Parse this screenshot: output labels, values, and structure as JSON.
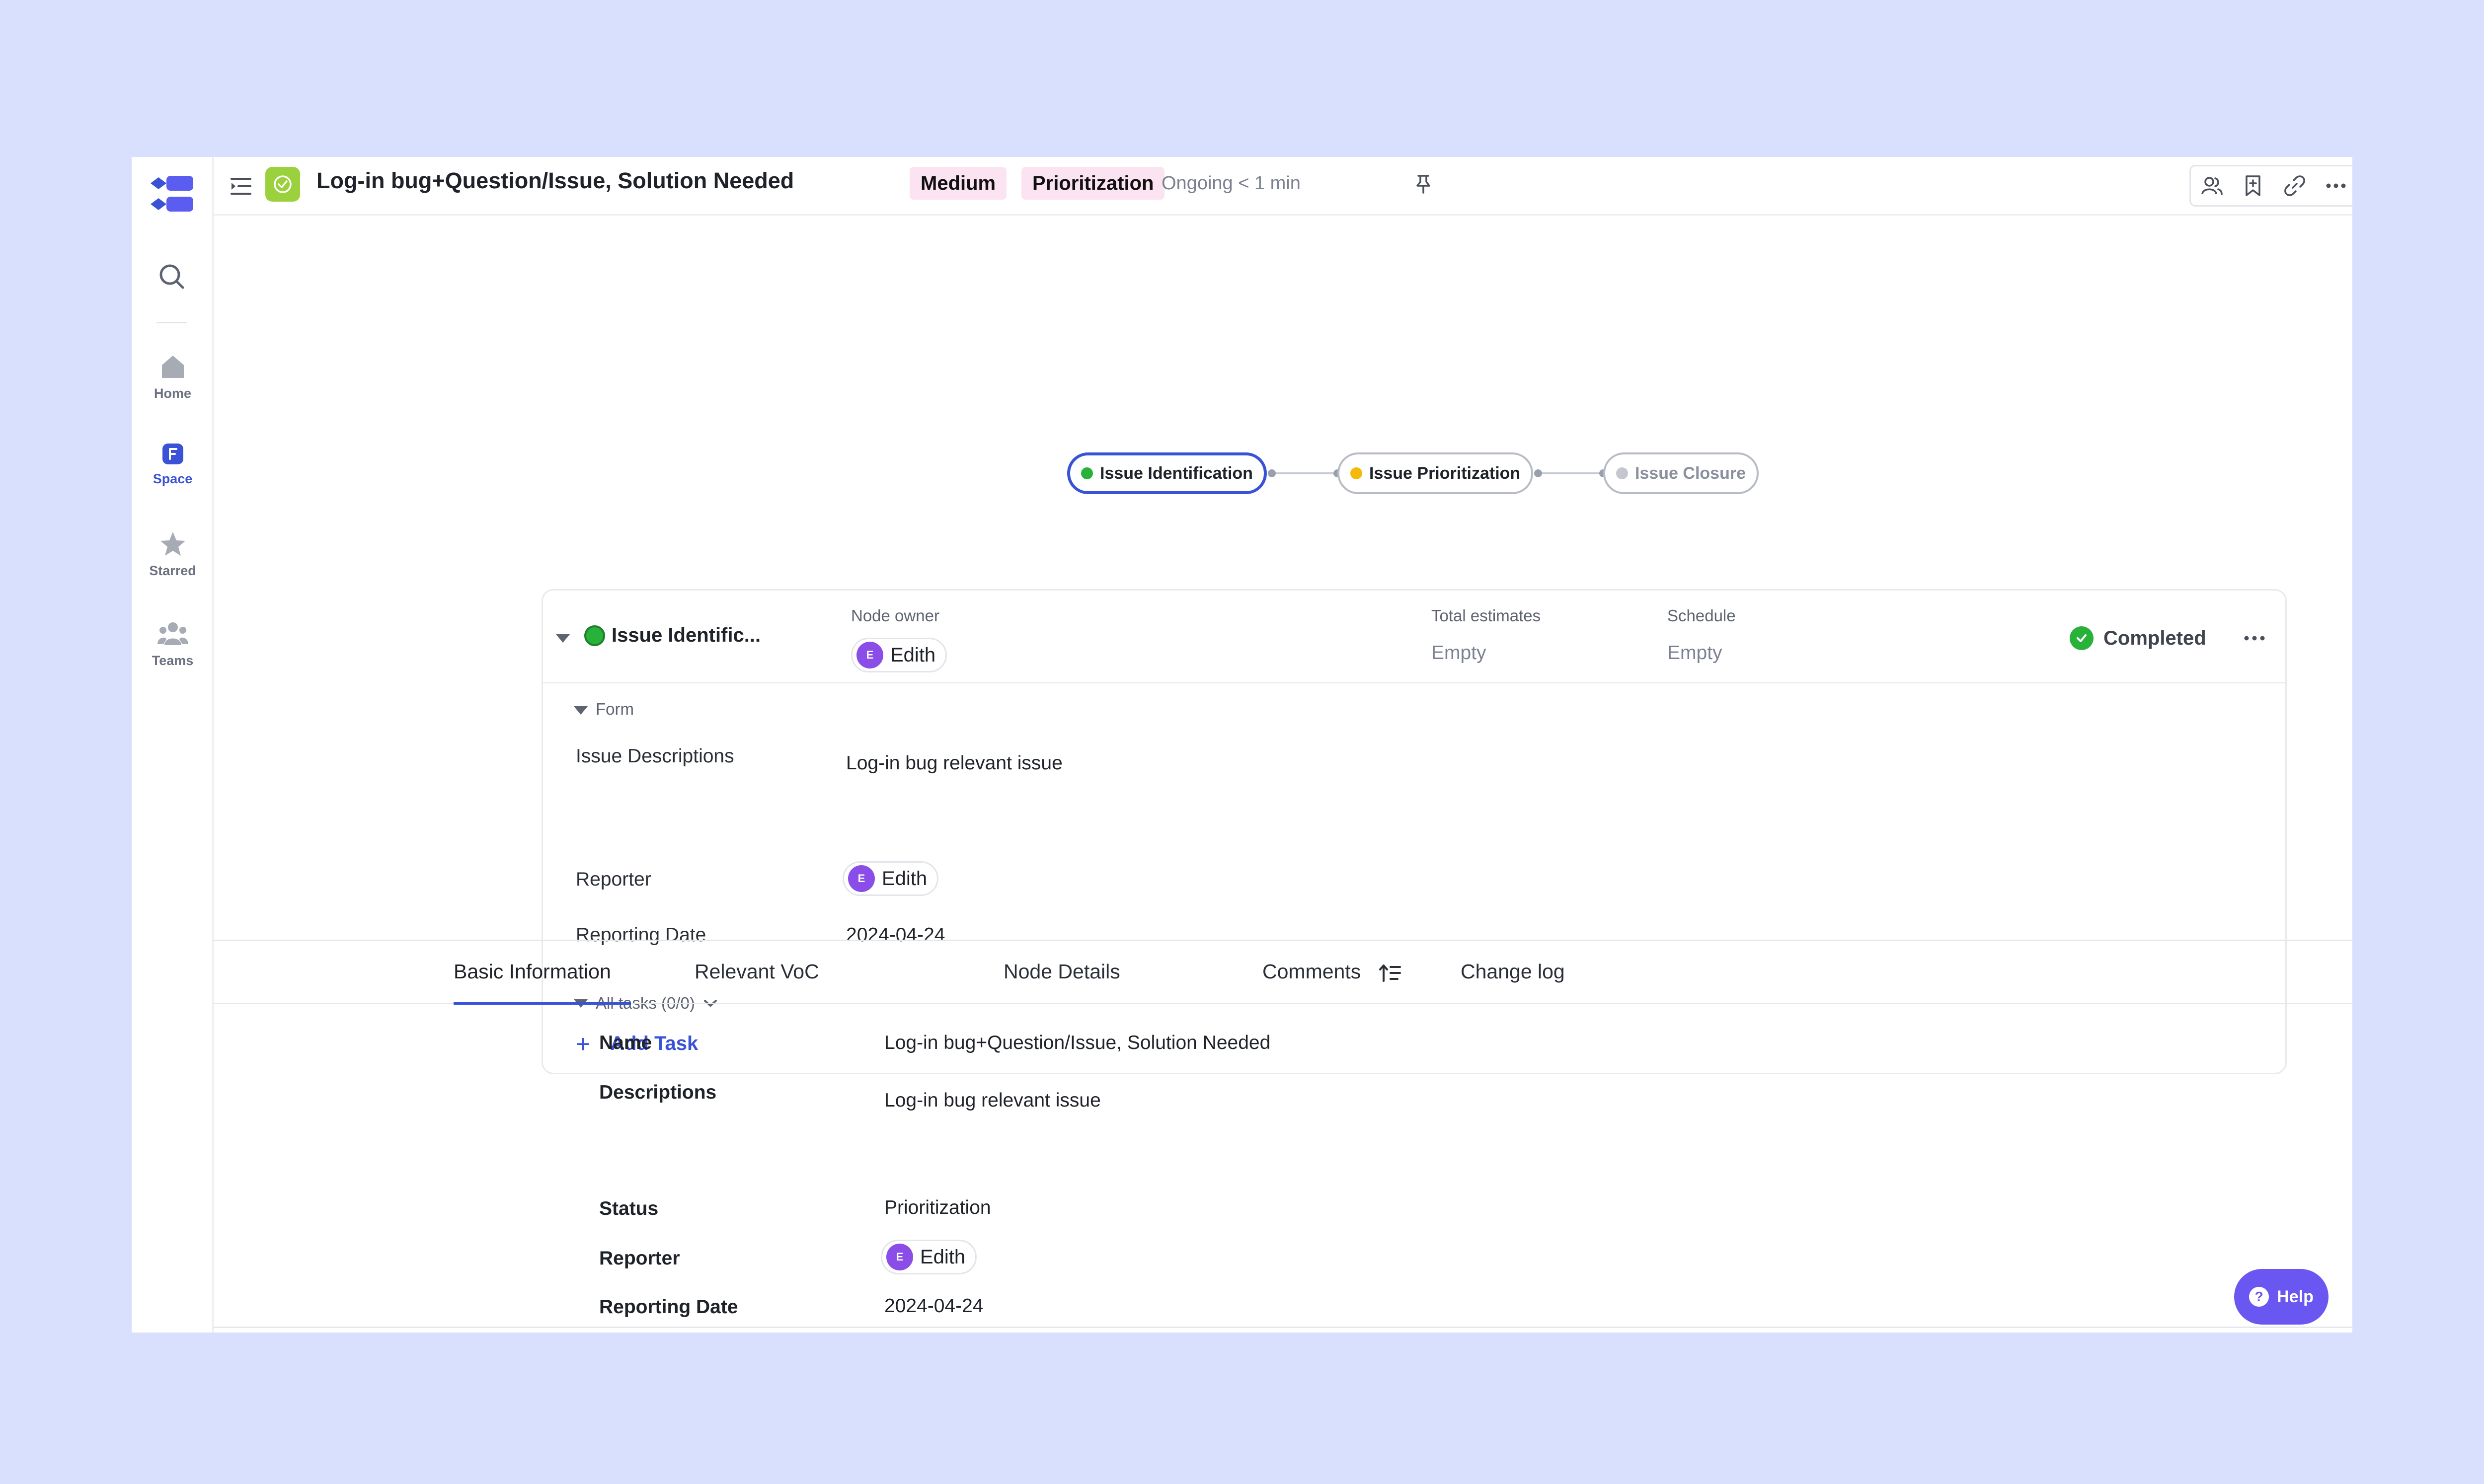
{
  "app": {
    "nav": [
      {
        "label": "Home",
        "icon": "home-icon"
      },
      {
        "label": "Space",
        "icon": "space-icon",
        "active": true
      },
      {
        "label": "Starred",
        "icon": "star-icon"
      },
      {
        "label": "Teams",
        "icon": "teams-icon"
      }
    ],
    "accent_color": "#3a53d6"
  },
  "header": {
    "title": "Log-in bug+Question/Issue, Solution Needed",
    "priority_tag": "Medium",
    "status_tag": "Prioritization",
    "ongoing": "Ongoing < 1 min",
    "actions": [
      "members-icon",
      "bookmark-icon",
      "link-icon",
      "more-icon"
    ]
  },
  "pipeline": {
    "nodes": [
      {
        "label": "Issue Identification",
        "dot_color": "#29b23a",
        "state": "current"
      },
      {
        "label": "Issue Prioritization",
        "dot_color": "#f5b90c",
        "state": "pending"
      },
      {
        "label": "Issue Closure",
        "dot_color": "#c4c7ce",
        "state": "inactive"
      }
    ]
  },
  "node_card": {
    "name": "Issue Identific...",
    "owner_label": "Node owner",
    "owner": {
      "initial": "E",
      "name": "Edith"
    },
    "estimates_label": "Total estimates",
    "estimates_value": "Empty",
    "schedule_label": "Schedule",
    "schedule_value": "Empty",
    "status": "Completed",
    "form_label": "Form",
    "form": {
      "descriptions_label": "Issue Descriptions",
      "descriptions_value": "Log-in bug relevant issue",
      "reporter_label": "Reporter",
      "reporter": {
        "initial": "E",
        "name": "Edith"
      },
      "date_label": "Reporting Date",
      "date_value": "2024-04-24"
    },
    "tasks_label": "All tasks (0/0)",
    "add_task_label": "Add Task"
  },
  "tabs": [
    {
      "label": "Basic Information",
      "active": true
    },
    {
      "label": "Relevant VoC"
    },
    {
      "label": "Node Details"
    },
    {
      "label": "Comments"
    },
    {
      "label": "Change log"
    }
  ],
  "basic_info": {
    "name_label": "Name",
    "name_value": "Log-in bug+Question/Issue, Solution Needed",
    "descriptions_label": "Descriptions",
    "descriptions_value": "Log-in bug relevant issue",
    "status_label": "Status",
    "status_value": "Prioritization",
    "reporter_label": "Reporter",
    "reporter": {
      "initial": "E",
      "name": "Edith"
    },
    "date_label": "Reporting Date",
    "date_value": "2024-04-24"
  },
  "help_label": "Help"
}
